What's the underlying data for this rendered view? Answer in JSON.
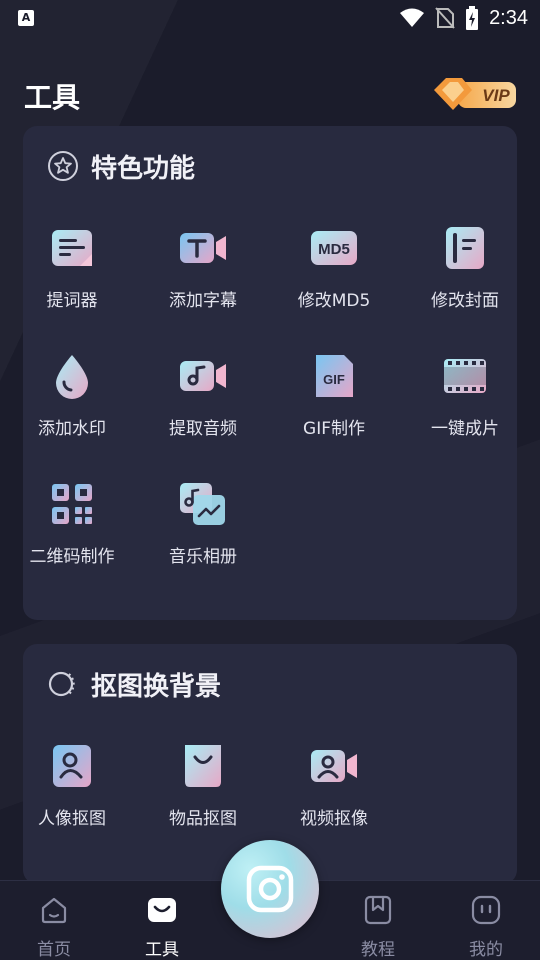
{
  "status_bar": {
    "left_icon_letter": "A",
    "time": "2:34",
    "icons": [
      "wifi-icon",
      "no-sim-icon",
      "battery-charging-icon"
    ]
  },
  "header": {
    "title": "工具",
    "vip_label": "VIP"
  },
  "feature_section": {
    "title": "特色功能",
    "icon": "star-circle-icon",
    "tools": [
      {
        "label": "提词器",
        "icon": "teleprompter-icon"
      },
      {
        "label": "添加字幕",
        "icon": "subtitle-camera-icon"
      },
      {
        "label": "修改MD5",
        "icon": "md5-icon",
        "icon_text": "MD5"
      },
      {
        "label": "修改封面",
        "icon": "cover-icon"
      },
      {
        "label": "添加水印",
        "icon": "water-drop-icon"
      },
      {
        "label": "提取音频",
        "icon": "audio-camera-icon"
      },
      {
        "label": "GIF制作",
        "icon": "gif-icon",
        "icon_text": "GIF"
      },
      {
        "label": "一键成片",
        "icon": "film-strip-icon"
      },
      {
        "label": "二维码制作",
        "icon": "qr-code-icon"
      },
      {
        "label": "音乐相册",
        "icon": "music-album-icon"
      }
    ]
  },
  "cutout_section": {
    "title": "抠图换背景",
    "icon": "cutout-circle-icon",
    "tools": [
      {
        "label": "人像抠图",
        "icon": "portrait-cutout-icon"
      },
      {
        "label": "物品抠图",
        "icon": "bag-cutout-icon"
      },
      {
        "label": "视频抠像",
        "icon": "video-cutout-icon"
      }
    ]
  },
  "bottom_nav": {
    "items": [
      {
        "label": "首页",
        "icon": "home-icon",
        "active": false
      },
      {
        "label": "工具",
        "icon": "toolbox-icon",
        "active": true
      },
      {
        "label": "教程",
        "icon": "bookmark-book-icon",
        "active": false
      },
      {
        "label": "我的",
        "icon": "profile-face-icon",
        "active": false
      }
    ],
    "center_button_icon": "camera-icon"
  },
  "colors": {
    "background": "#1b1c2b",
    "card": "#282a3f",
    "icon_cyan": "#9fe0ee",
    "icon_pink": "#e9a9c4",
    "vip_gold": "#f3b069"
  }
}
